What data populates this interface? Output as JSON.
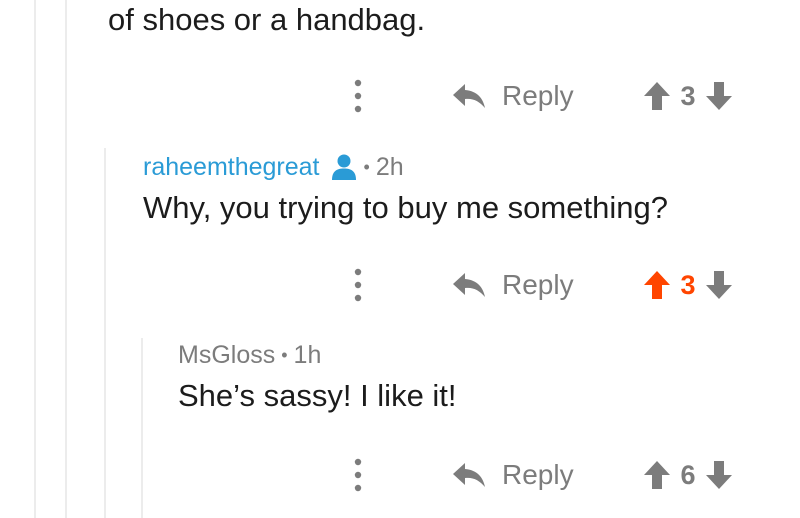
{
  "comments": [
    {
      "body": "of shoes or a handbag.",
      "reply_label": "Reply",
      "score": "3",
      "upvoted": false
    },
    {
      "username": "raheemthegreat",
      "op_icon": "user-icon",
      "separator": "•",
      "time": "2h",
      "body": "Why, you trying to buy me something?",
      "reply_label": "Reply",
      "score": "3",
      "upvoted": true
    },
    {
      "username": "MsGloss",
      "separator": "•",
      "time": "1h",
      "body": "She’s sassy! I like it!",
      "reply_label": "Reply",
      "score": "6",
      "upvoted": false
    }
  ],
  "colors": {
    "username_link": "#2a9bd6",
    "upvote_active": "#ff4500",
    "muted": "#7c7c7c"
  },
  "icons": [
    "more-vertical-icon",
    "reply-arrow-icon",
    "upvote-arrow-icon",
    "downvote-arrow-icon",
    "user-icon"
  ]
}
